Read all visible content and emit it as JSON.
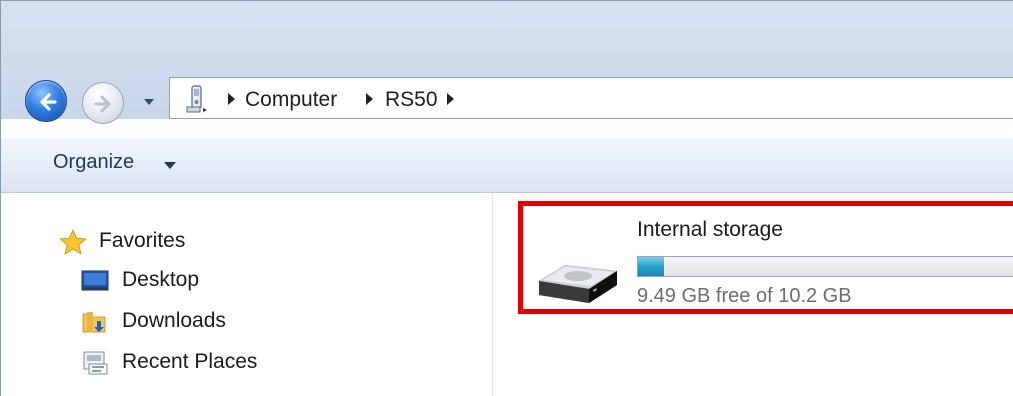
{
  "navigation": {
    "back_icon": "back-arrow-icon",
    "forward_icon": "forward-arrow-icon",
    "recent_icon": "chevron-down-icon"
  },
  "address": {
    "location_icon": "portable-device-icon",
    "breadcrumbs": [
      "Computer",
      "RS50"
    ]
  },
  "toolbar": {
    "organize_label": "Organize"
  },
  "sidebar": {
    "favorites_label": "Favorites",
    "items": [
      {
        "label": "Desktop",
        "icon": "desktop-icon"
      },
      {
        "label": "Downloads",
        "icon": "downloads-folder-icon"
      },
      {
        "label": "Recent Places",
        "icon": "recent-places-icon"
      }
    ]
  },
  "drive": {
    "name": "Internal storage",
    "free_text": "9.49 GB free of 10.2 GB",
    "used_fraction": 0.07,
    "bar_color": "#2aa3cf",
    "highlight_color": "#e00000"
  }
}
